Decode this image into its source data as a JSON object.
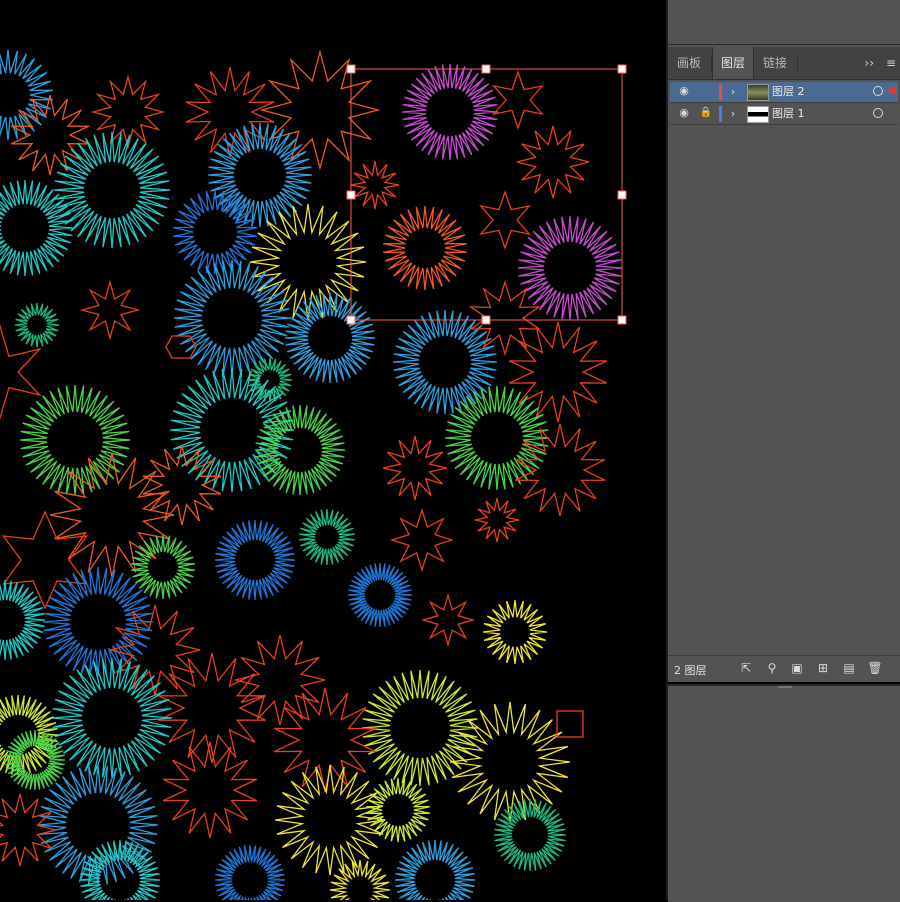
{
  "panel": {
    "tabs": [
      {
        "label": "画板"
      },
      {
        "label": "图层"
      },
      {
        "label": "链接"
      }
    ],
    "collapse_label": "››",
    "menu_label": "≡",
    "layers": [
      {
        "name": "图层 2",
        "color": "#e84a4a",
        "selected": true,
        "locked": false,
        "visible": true
      },
      {
        "name": "图层 1",
        "color": "#4d7fe0",
        "selected": false,
        "locked": true,
        "visible": true
      }
    ],
    "footer": {
      "count_label": "2 图层"
    }
  },
  "icons": {
    "visibility": "eye-icon",
    "lock": "lock-icon",
    "expand": "chevron-right-icon",
    "target": "target-circle-icon",
    "export": "export-icon",
    "locate": "search-icon",
    "clipping_mask": "clipping-mask-icon",
    "new_sublayer": "new-sublayer-icon",
    "new_layer": "new-layer-icon",
    "delete": "trash-icon"
  },
  "canvas": {
    "background": "#000000",
    "selection_color": "#ff5a5a",
    "palette": [
      "#e8401c",
      "#f05a20",
      "#f0e23a",
      "#c8e83a",
      "#4ad24a",
      "#1fb87a",
      "#20c8c8",
      "#2ea0e0",
      "#1e78d8",
      "#c84ad0"
    ]
  }
}
